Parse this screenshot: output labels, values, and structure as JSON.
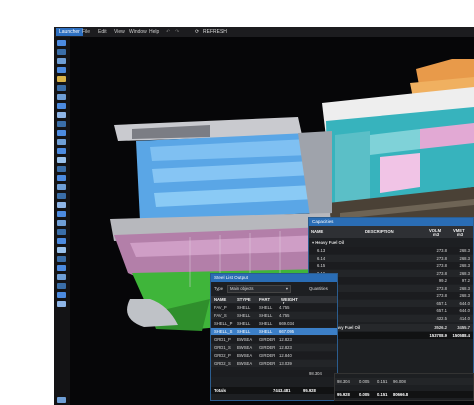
{
  "menu": {
    "launcher": "Launcher",
    "file": "File",
    "edit": "Edit",
    "view": "View",
    "window": "Window",
    "help": "Help",
    "refresh": "REFRESH"
  },
  "capacities": {
    "title": "Capacities",
    "headers": {
      "name": "NAME",
      "description": "DESCRIPTION",
      "vcm": "VOLM",
      "vcm_unit": "m3",
      "vmet": "VMET",
      "vmet_unit": "m3"
    },
    "group": "Heavy Fuel Oil",
    "rows": [
      [
        "6.13",
        "",
        "273.8",
        "268.3"
      ],
      [
        "6.14",
        "",
        "273.8",
        "268.3"
      ],
      [
        "6.15",
        "",
        "273.8",
        "268.3"
      ],
      [
        "6.16",
        "",
        "273.8",
        "268.3"
      ],
      [
        "6.39",
        "",
        "99.2",
        "97.2"
      ],
      [
        "6.43",
        "",
        "273.8",
        "268.3"
      ],
      [
        "6.44",
        "",
        "273.8",
        "268.3"
      ],
      [
        "6.45",
        "",
        "657.1",
        "644.0"
      ],
      [
        "6.46",
        "",
        "657.1",
        "644.0"
      ],
      [
        "6.65",
        "",
        "422.5",
        "414.0"
      ]
    ],
    "group_total": [
      "Totals of Heavy Fuel Oil",
      "3526.2",
      "3455.7"
    ],
    "grand_total": [
      "Totals",
      "153708.9",
      "150588.4"
    ]
  },
  "steel": {
    "title": "Steel List Output",
    "type_label": "Type",
    "type_value": "Main objects",
    "quantities": "Quantities",
    "headers": [
      "NAME",
      "STYPE",
      "PART",
      "WEIGHT",
      "t"
    ],
    "rows": [
      [
        "FAV_P",
        "SHELL",
        "SHELL",
        "4.755"
      ],
      [
        "FAV_S",
        "SHELL",
        "SHELL",
        "4.755"
      ],
      [
        "SHELL_P",
        "SHELL",
        "SHELL",
        "669.034"
      ],
      [
        "SHELL_S",
        "SHELL",
        "SHELL",
        "667.095"
      ],
      [
        "GRD1_P",
        "BWSEA",
        "GIRDER",
        "12.823"
      ],
      [
        "GRD1_S",
        "BWSEA",
        "GIRDER",
        "12.823"
      ],
      [
        "GRD2_P",
        "BWSEA",
        "GIRDER",
        "12.840"
      ],
      [
        "GRD2_S",
        "BWSEA",
        "GIRDER",
        "13.039"
      ]
    ],
    "extra_row": [
      "98.304",
      "0.005",
      "0.151",
      "96.008"
    ],
    "totals": [
      "Totals",
      "7443.481",
      "95.928",
      "0.005",
      "0.151",
      "80666.8"
    ]
  }
}
